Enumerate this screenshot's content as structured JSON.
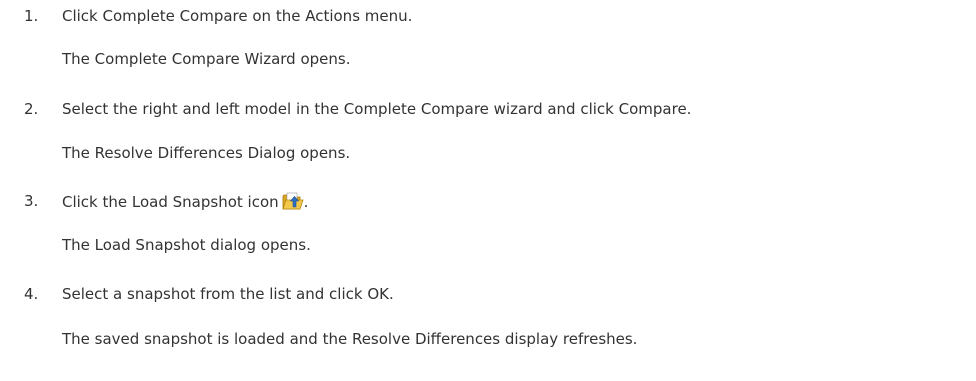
{
  "steps": [
    {
      "number": "1.",
      "instruction": "Click Complete Compare on the Actions menu.",
      "result": "The Complete Compare Wizard opens."
    },
    {
      "number": "2.",
      "instruction": "Select the right and left model in the Complete Compare wizard and click Compare.",
      "result": "The Resolve Differences Dialog opens."
    },
    {
      "number": "3.",
      "instruction_before_icon": "Click the Load Snapshot icon",
      "icon": "load-snapshot-icon",
      "instruction_after_icon": ".",
      "result": "The Load Snapshot dialog opens."
    },
    {
      "number": "4.",
      "instruction": "Select a snapshot from the list and click OK.",
      "result": "The saved snapshot is loaded and the Resolve Differences display refreshes."
    }
  ],
  "colors": {
    "text": "#333333",
    "folder_yellow": "#f2c94c",
    "arrow_blue": "#2f6fbf"
  }
}
